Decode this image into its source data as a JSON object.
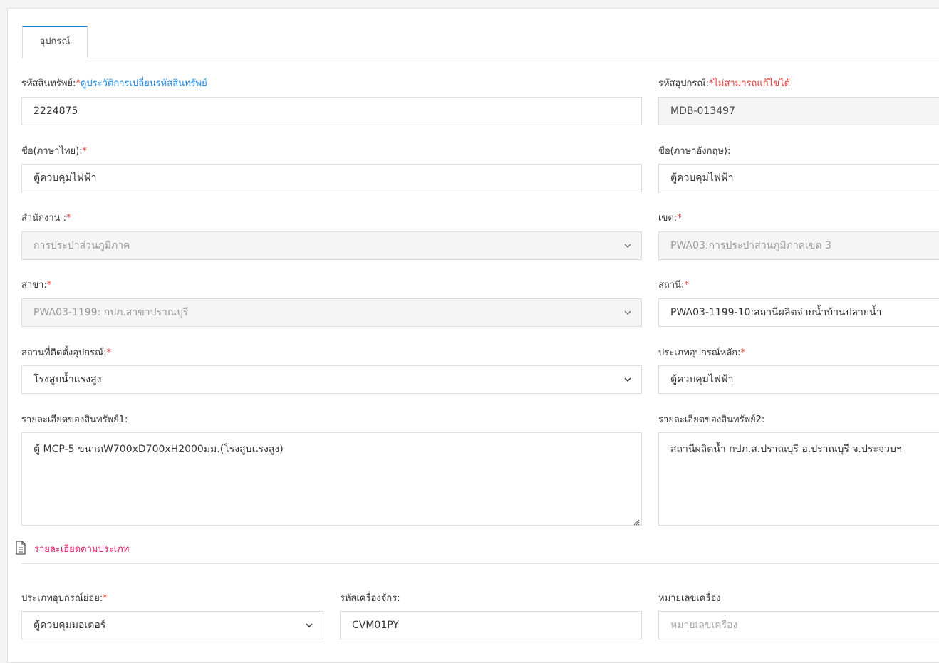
{
  "tab": {
    "label": "อุปกรณ์"
  },
  "asset_code": {
    "label": "รหัสสินทรัพย์:",
    "req": "*",
    "link": "ดูประวัติการเปลี่ยนรหัสสินทรัพย์",
    "value": "2224875"
  },
  "equip_code": {
    "label": "รหัสอุปกรณ์:",
    "req": "*",
    "note": "ไม่สามารถแก้ไขได้",
    "value": "MDB-013497"
  },
  "name_th": {
    "label": "ชื่อ(ภาษาไทย):",
    "req": "*",
    "value": "ตู้ควบคุมไฟฟ้า"
  },
  "name_en": {
    "label": "ชื่อ(ภาษาอังกฤษ):",
    "value": "ตู้ควบคุมไฟฟ้า"
  },
  "office": {
    "label": "สำนักงาน :",
    "req": "*",
    "value": "การประปาส่วนภูมิภาค"
  },
  "zone": {
    "label": "เขต:",
    "req": "*",
    "value": "PWA03:การประปาส่วนภูมิภาคเขต 3"
  },
  "branch": {
    "label": "สาขา:",
    "req": "*",
    "value": "PWA03-1199: กปภ.สาขาปราณบุรี"
  },
  "station": {
    "label": "สถานี:",
    "req": "*",
    "value": "PWA03-1199-10:สถานีผลิตจ่ายน้ำบ้านปลายน้ำ"
  },
  "install_place": {
    "label": "สถานที่ติดตั้งอุปกรณ์:",
    "req": "*",
    "value": "โรงสูบน้ำแรงสูง"
  },
  "main_type": {
    "label": "ประเภทอุปกรณ์หลัก:",
    "req": "*",
    "value": "ตู้ควบคุมไฟฟ้า"
  },
  "detail1": {
    "label": "รายละเอียดของสินทรัพย์1:",
    "value": "ตู้ MCP-5 ขนาดW700xD700xH2000มม.(โรงสูบแรงสูง)"
  },
  "detail2": {
    "label": "รายละเอียดของสินทรัพย์2:",
    "value": "สถานีผลิตน้ำ กปภ.ส.ปราณบุรี อ.ปราณบุรี จ.ประจวบฯ"
  },
  "section": {
    "title": "รายละเอียดตามประเภท"
  },
  "sub_type": {
    "label": "ประเภทอุปกรณ์ย่อย:",
    "req": "*",
    "value": "ตู้ควบคุมมอเตอร์"
  },
  "machine_code": {
    "label": "รหัสเครื่องจักร:",
    "value": "CVM01PY"
  },
  "machine_no": {
    "label": "หมายเลขเครื่อง",
    "placeholder": "หมายเลขเครื่อง"
  },
  "icons": {
    "dropdown": "chevron-down-icon",
    "section": "document-icon",
    "resize": "resize-grip-icon"
  },
  "colors": {
    "accent": "#1e88e5",
    "required": "#e53935",
    "section": "#d81b60"
  }
}
